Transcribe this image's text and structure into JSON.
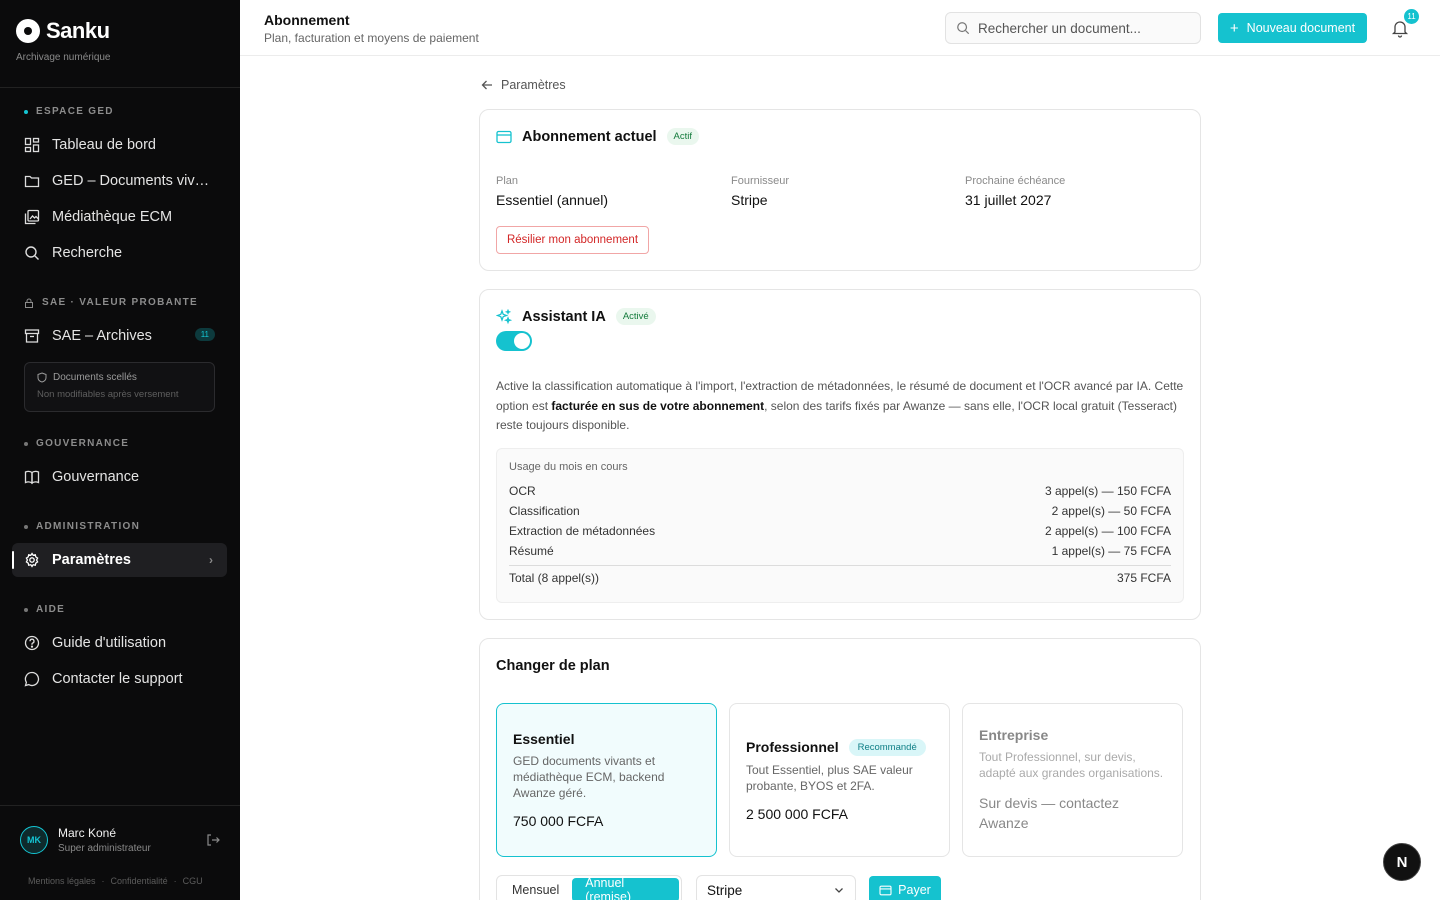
{
  "brand": {
    "name": "Sanku",
    "subtitle": "Archivage numérique"
  },
  "sidebar": {
    "sections": {
      "ged": "ESPACE GED",
      "sae": "SAE · VALEUR PROBANTE",
      "gouv": "GOUVERNANCE",
      "admin": "ADMINISTRATION",
      "aide": "AIDE"
    },
    "items": {
      "dashboard": "Tableau de bord",
      "ged_docs": "GED – Documents vivants",
      "mediatheque": "Médiathèque ECM",
      "recherche": "Recherche",
      "sae_archives": "SAE – Archives",
      "sae_badge": "11",
      "gouvernance": "Gouvernance",
      "parametres": "Paramètres",
      "guide": "Guide d'utilisation",
      "support": "Contacter le support"
    },
    "sealed": {
      "title": "Documents scellés",
      "subtitle": "Non modifiables après versement"
    },
    "user": {
      "initials": "MK",
      "name": "Marc Koné",
      "role": "Super administrateur"
    },
    "footer": {
      "legal": "Mentions légales",
      "privacy": "Confidentialité",
      "cgu": "CGU",
      "sep": "·"
    }
  },
  "header": {
    "title": "Abonnement",
    "subtitle": "Plan, facturation et moyens de paiement",
    "search_placeholder": "Rechercher un document...",
    "new_button": "Nouveau document",
    "notif_count": "11"
  },
  "back_link": "Paramètres",
  "current_sub": {
    "title": "Abonnement actuel",
    "badge": "Actif",
    "plan_label": "Plan",
    "plan_value": "Essentiel (annuel)",
    "provider_label": "Fournisseur",
    "provider_value": "Stripe",
    "next_label": "Prochaine échéance",
    "next_value": "31 juillet 2027",
    "cancel_button": "Résilier mon abonnement"
  },
  "assistant": {
    "title": "Assistant IA",
    "badge": "Activé",
    "toggle_on": true,
    "desc_1": "Active la classification automatique à l'import, l'extraction de métadonnées, le résumé de document et l'OCR avancé par IA. Cette option est ",
    "desc_bold": "facturée en sus de votre abonnement",
    "desc_2": ", selon des tarifs fixés par Awanze — sans elle, l'OCR local gratuit (Tesseract) reste toujours disponible.",
    "usage_title": "Usage du mois en cours",
    "usage": [
      {
        "label": "OCR",
        "value": "3 appel(s) — 150 FCFA"
      },
      {
        "label": "Classification",
        "value": "2 appel(s) — 50 FCFA"
      },
      {
        "label": "Extraction de métadonnées",
        "value": "2 appel(s) — 100 FCFA"
      },
      {
        "label": "Résumé",
        "value": "1 appel(s) — 75 FCFA"
      }
    ],
    "total_label": "Total (8 appel(s))",
    "total_value": "375 FCFA"
  },
  "change_plan": {
    "title": "Changer de plan",
    "plans": [
      {
        "name": "Essentiel",
        "desc": "GED documents vivants et médiathèque ECM, backend Awanze géré.",
        "price": "750 000 FCFA"
      },
      {
        "name": "Professionnel",
        "badge": "Recommandé",
        "desc": "Tout Essentiel, plus SAE valeur probante, BYOS et 2FA.",
        "price": "2 500 000 FCFA"
      },
      {
        "name": "Entreprise",
        "desc": "Tout Professionnel, sur devis, adapté aux grandes organisations.",
        "price": "Sur devis — contactez Awanze"
      }
    ],
    "period_monthly": "Mensuel",
    "period_annual": "Annuel (remise)",
    "provider_select": "Stripe",
    "pay_button": "Payer"
  },
  "floating_button": "N",
  "colors": {
    "accent": "#15c2cf",
    "sidebar_bg": "#0b0b0c",
    "danger": "#d32626"
  }
}
